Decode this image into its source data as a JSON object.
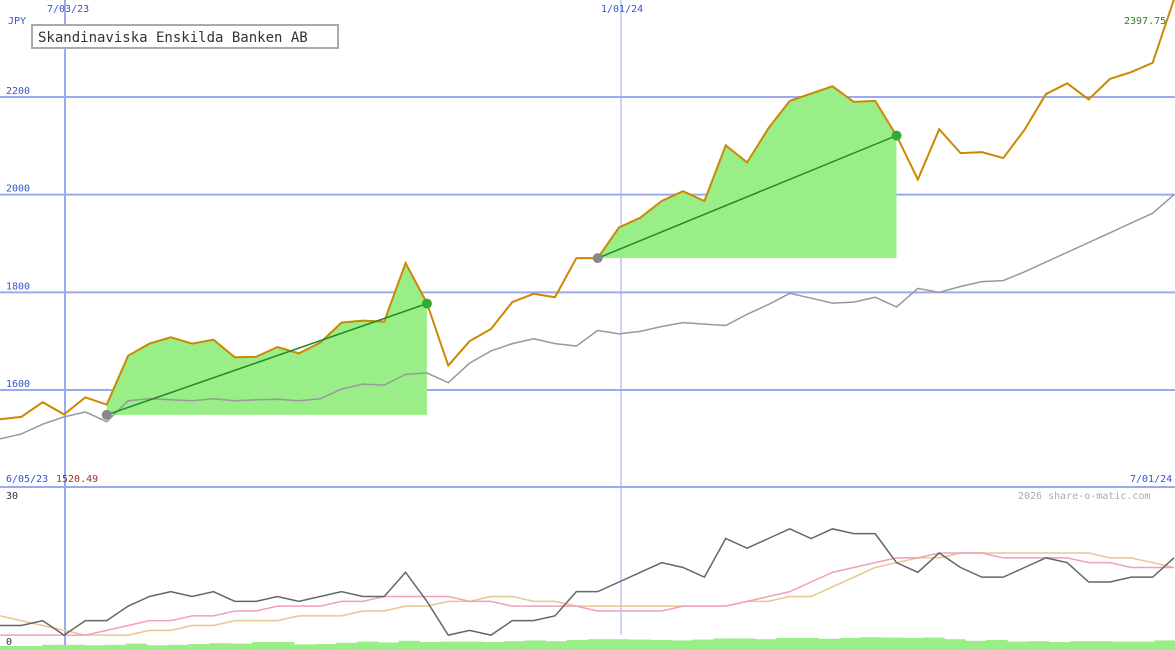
{
  "title": "Skandinaviska Enskilda Banken AB",
  "currency": "JPY",
  "watermark": "2026 share-o-matic.com",
  "date_labels": {
    "top_left": "7/03/23",
    "top_mid": "1/01/24",
    "bottom_left": "6/05/23",
    "bottom_right": "7/01/24"
  },
  "last_value_label": "2397.75",
  "min_value_label": "1520.49",
  "colors": {
    "price": "#cc8800",
    "comparison": "#999999",
    "fill": "#99ee88",
    "trend": "#228822",
    "grid": "#99aaee",
    "axis_text": "#3355cc",
    "last_value": "#228822",
    "min_value": "#993333",
    "oscillator": "#666666",
    "osc_fast": "#f0a0b8",
    "osc_slow": "#e6c890",
    "volume": "#99ee88"
  },
  "chart_data": [
    {
      "type": "line",
      "panel": "price",
      "ylim": [
        1520.49,
        2397.75
      ],
      "yticks": [
        1600,
        1800,
        2000,
        2200
      ],
      "x_count": 52,
      "series": [
        {
          "key": "price",
          "values": [
            1540,
            1545,
            1575,
            1550,
            1585,
            1570,
            1670,
            1695,
            1708,
            1695,
            1703,
            1667,
            1668,
            1688,
            1675,
            1697,
            1738,
            1742,
            1740,
            1860,
            1778,
            1650,
            1700,
            1725,
            1780,
            1797,
            1790,
            1870,
            1870,
            1933,
            1953,
            1987,
            2007,
            1987,
            2101,
            2066,
            2136,
            2192,
            2207,
            2222,
            2190,
            2192,
            2121,
            2031,
            2134,
            2085,
            2087,
            2075,
            2133,
            2206,
            2228,
            2195,
            2237,
            2251,
            2270,
            2400
          ]
        },
        {
          "key": "comparison",
          "values": [
            1500,
            1510,
            1530,
            1545,
            1555,
            1535,
            1578,
            1582,
            1580,
            1578,
            1582,
            1578,
            1580,
            1581,
            1578,
            1582,
            1602,
            1612,
            1610,
            1632,
            1635,
            1615,
            1655,
            1680,
            1695,
            1705,
            1695,
            1690,
            1722,
            1715,
            1720,
            1730,
            1738,
            1735,
            1732,
            1755,
            1775,
            1798,
            1788,
            1778,
            1780,
            1790,
            1770,
            1808,
            1800,
            1812,
            1822,
            1824,
            1842,
            1862,
            1882,
            1902,
            1922,
            1942,
            1962,
            2000
          ]
        }
      ],
      "trades": [
        {
          "start_index": 5,
          "start_value": 1549,
          "end_index": 20,
          "end_value": 1777
        },
        {
          "start_index": 28,
          "start_value": 1870,
          "end_index": 42,
          "end_value": 2121
        }
      ]
    },
    {
      "type": "line",
      "panel": "oscillator",
      "ylim": [
        0,
        30
      ],
      "yticks": [
        0,
        30
      ],
      "x_count": 56,
      "series": [
        {
          "key": "oscillator",
          "values": [
            3,
            3,
            4,
            1,
            4,
            4,
            7,
            9,
            10,
            9,
            10,
            8,
            8,
            9,
            8,
            9,
            10,
            9,
            9,
            14,
            8,
            1,
            2,
            1,
            4,
            4,
            5,
            10,
            10,
            12,
            14,
            16,
            15,
            13,
            21,
            19,
            21,
            23,
            21,
            23,
            22,
            22,
            16,
            14,
            18,
            15,
            13,
            13,
            15,
            17,
            16,
            12,
            12,
            13,
            13,
            17
          ]
        },
        {
          "key": "fast",
          "values": [
            1,
            1,
            1,
            1,
            1,
            2,
            3,
            4,
            4,
            5,
            5,
            6,
            6,
            7,
            7,
            7,
            8,
            8,
            9,
            9,
            9,
            9,
            8,
            8,
            7,
            7,
            7,
            7,
            6,
            6,
            6,
            6,
            7,
            7,
            7,
            8,
            9,
            10,
            12,
            14,
            15,
            16,
            17,
            17,
            18,
            18,
            18,
            17,
            17,
            17,
            17,
            16,
            16,
            15,
            15,
            15
          ]
        },
        {
          "key": "slow",
          "values": [
            5,
            4,
            3,
            2,
            1,
            1,
            1,
            2,
            2,
            3,
            3,
            4,
            4,
            4,
            5,
            5,
            5,
            6,
            6,
            7,
            7,
            8,
            8,
            9,
            9,
            8,
            8,
            7,
            7,
            7,
            7,
            7,
            7,
            7,
            7,
            8,
            8,
            9,
            9,
            11,
            13,
            15,
            16,
            17,
            17,
            18,
            18,
            18,
            18,
            18,
            18,
            18,
            17,
            17,
            16,
            15
          ]
        }
      ],
      "volume": [
        1,
        1,
        1.3,
        1.3,
        1.2,
        1.3,
        1.6,
        1.2,
        1.3,
        1.5,
        1.7,
        1.6,
        2,
        2,
        1.4,
        1.5,
        1.8,
        2.1,
        1.9,
        2.3,
        2.0,
        2.1,
        2.1,
        2.0,
        2.2,
        2.4,
        2.2,
        2.5,
        2.7,
        2.7,
        2.6,
        2.5,
        2.4,
        2.6,
        2.9,
        2.9,
        2.7,
        3.0,
        3.0,
        2.8,
        3.0,
        3.2,
        3.1,
        3.0,
        3.1,
        2.7,
        2.3,
        2.5,
        2.1,
        2.2,
        2.0,
        2.2,
        2.2,
        2.1,
        2.1,
        2.4
      ]
    }
  ]
}
